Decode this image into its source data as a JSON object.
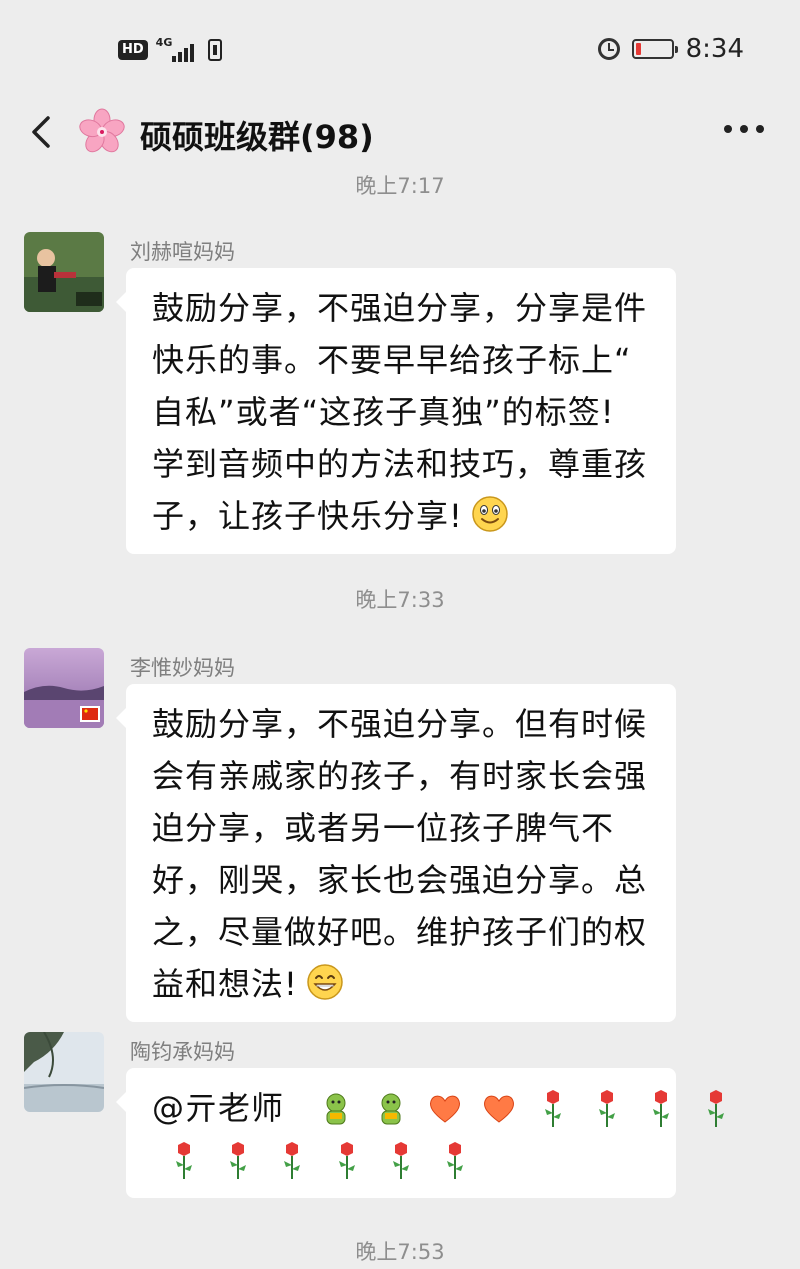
{
  "status_bar": {
    "hd_label": "HD",
    "network_label": "4G",
    "time": "8:34",
    "icons": [
      "hd-badge-icon",
      "signal-icon",
      "sim-icon",
      "alarm-icon",
      "battery-low-icon"
    ],
    "battery_color": "#e53935"
  },
  "header": {
    "title": "硕硕班级群(98)",
    "back_icon": "chevron-left-icon",
    "more_icon": "ellipsis-icon",
    "group_avatar": "cherry-blossom-icon"
  },
  "timestamps": [
    "晚上7:17",
    "晚上7:33",
    "晚上7:53"
  ],
  "messages": [
    {
      "sender": "刘赫喧妈妈",
      "lines": [
        "鼓励分享，不强迫分享，分享是件",
        "快乐的事。不要早早给孩子标上“",
        "自私”或者“这孩子真独”的标签!",
        "学到音频中的方法和技巧，尊重孩",
        "子，让孩子快乐分享!"
      ],
      "emoji": "smiling-face-icon"
    },
    {
      "sender": "李惟妙妈妈",
      "lines": [
        "鼓励分享，不强迫分享。但有时候",
        "会有亲戚家的孩子，有时家长会强",
        "迫分享，或者另一位孩子脾气不",
        "好，刚哭，家长也会强迫分享。总",
        "之，尽量做好吧。维护孩子们的权",
        "益和想法!"
      ],
      "emoji": "grinning-face-icon"
    },
    {
      "sender": "陶钧承妈妈",
      "mention": "@亓老师",
      "emoji_line1": [
        "green-man-icon",
        "green-man-icon",
        "heart-icon",
        "heart-icon",
        "rose-icon",
        "rose-icon",
        "rose-icon",
        "rose-icon"
      ],
      "emoji_line2": [
        "rose-icon",
        "rose-icon",
        "rose-icon",
        "rose-icon",
        "rose-icon",
        "rose-icon"
      ]
    }
  ],
  "colors": {
    "background": "#ededed",
    "bubble": "#ffffff",
    "timestamp": "#8e8e8e",
    "sender": "#7f7f7f"
  }
}
